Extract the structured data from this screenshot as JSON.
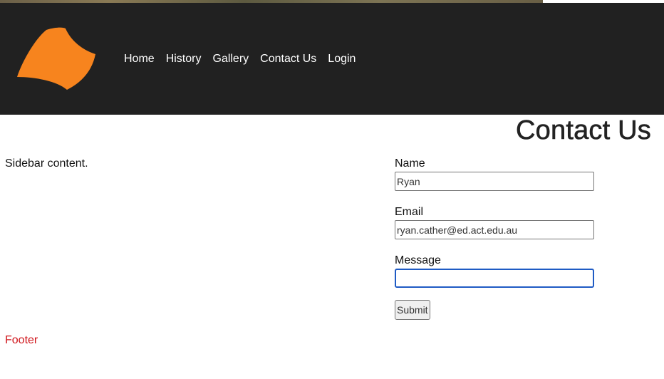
{
  "header": {
    "logo_name": "orange-shape-logo",
    "nav": [
      "Home",
      "History",
      "Gallery",
      "Contact Us",
      "Login"
    ]
  },
  "page": {
    "title": "Contact Us"
  },
  "sidebar": {
    "text": "Sidebar content."
  },
  "form": {
    "name_label": "Name",
    "name_value": "Ryan",
    "email_label": "Email",
    "email_value": "ryan.cather@ed.act.edu.au",
    "message_label": "Message",
    "message_value": "",
    "submit_label": "Submit"
  },
  "footer": {
    "text": "Footer"
  },
  "colors": {
    "header_bg": "#212121",
    "logo": "#f7841e",
    "footer_text": "#d0161c",
    "focus": "#1f5bc4"
  }
}
